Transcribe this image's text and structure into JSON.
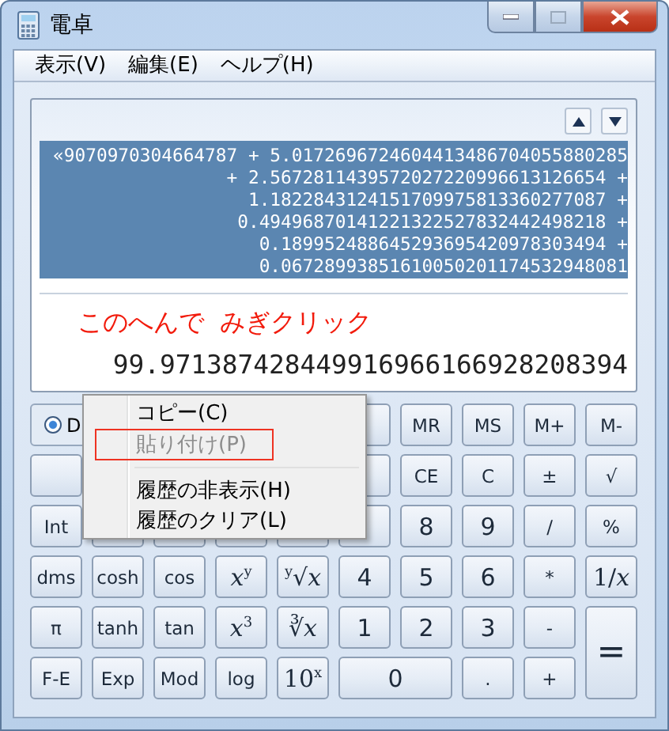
{
  "window": {
    "title": "電卓"
  },
  "menu_bar": [
    "表示(V)",
    "編集(E)",
    "ヘルプ(H)"
  ],
  "display": {
    "history_selected": true,
    "history": [
      "«9070970304664787 + 5.0172696724604413486704055880285",
      "+ 2.5672811439572027220996613126654 +",
      "1.1822843124151709975813360277087 +",
      "0.49496870141221322527832442498218 +",
      "0.189952488645293695420978303494 +",
      "0.06728993851610050201174532948081"
    ],
    "annotation": "このへんで  みぎクリック",
    "result": "99.971387428449916966166928208394"
  },
  "keys": [
    {
      "kind": "radio",
      "label": "D",
      "selected": true
    },
    {
      "kind": "covered"
    },
    {
      "kind": "key",
      "label": "MR"
    },
    {
      "kind": "key",
      "label": "MS"
    },
    {
      "kind": "key",
      "label": "M+"
    },
    {
      "kind": "key",
      "label": "M-"
    },
    {
      "kind": "covered"
    },
    {
      "kind": "hidden"
    },
    {
      "kind": "hidden"
    },
    {
      "kind": "hidden"
    },
    {
      "kind": "hidden"
    },
    {
      "kind": "covered"
    },
    {
      "kind": "key",
      "label": "CE"
    },
    {
      "kind": "key",
      "label": "C"
    },
    {
      "kind": "key",
      "label": "±"
    },
    {
      "kind": "key",
      "label": "√"
    },
    {
      "kind": "key",
      "label": "Int"
    },
    {
      "kind": "covered"
    },
    {
      "kind": "covered"
    },
    {
      "kind": "covered"
    },
    {
      "kind": "covered"
    },
    {
      "kind": "covered"
    },
    {
      "kind": "digit",
      "label": "8"
    },
    {
      "kind": "digit",
      "label": "9"
    },
    {
      "kind": "key",
      "label": "/"
    },
    {
      "kind": "key",
      "label": "%"
    },
    {
      "kind": "key",
      "label": "dms"
    },
    {
      "kind": "key",
      "label": "cosh"
    },
    {
      "kind": "key",
      "label": "cos"
    },
    {
      "kind": "math",
      "label": "*x*$^{y}$"
    },
    {
      "kind": "math",
      "label": "$^{y}$√*x*"
    },
    {
      "kind": "digit",
      "label": "4"
    },
    {
      "kind": "digit",
      "label": "5"
    },
    {
      "kind": "digit",
      "label": "6"
    },
    {
      "kind": "key",
      "label": "*"
    },
    {
      "kind": "math",
      "label": "1/*x*"
    },
    {
      "kind": "key",
      "label": "π"
    },
    {
      "kind": "key",
      "label": "tanh"
    },
    {
      "kind": "key",
      "label": "tan"
    },
    {
      "kind": "math",
      "label": "*x*$^{3}$"
    },
    {
      "kind": "math",
      "label": "∛*x*"
    },
    {
      "kind": "digit",
      "label": "1"
    },
    {
      "kind": "digit",
      "label": "2"
    },
    {
      "kind": "digit",
      "label": "3"
    },
    {
      "kind": "key",
      "label": "-"
    },
    {
      "kind": "tall",
      "label": "="
    },
    {
      "kind": "key",
      "label": "F-E"
    },
    {
      "kind": "key",
      "label": "Exp"
    },
    {
      "kind": "key",
      "label": "Mod"
    },
    {
      "kind": "key",
      "label": "log"
    },
    {
      "kind": "math",
      "label": "10$^{x}$"
    },
    {
      "kind": "wide",
      "label": "0"
    },
    {
      "kind": "key",
      "label": "."
    },
    {
      "kind": "key",
      "label": "+"
    }
  ],
  "context_menu": [
    {
      "kind": "item",
      "label": "コピー(C)",
      "disabled": false,
      "highlighted": false
    },
    {
      "kind": "item",
      "label": "貼り付け(P)",
      "disabled": true,
      "highlighted": true
    },
    {
      "kind": "separator"
    },
    {
      "kind": "item",
      "label": "履歴の非表示(H)",
      "disabled": false,
      "highlighted": false
    },
    {
      "kind": "item",
      "label": "履歴のクリア(L)",
      "disabled": false,
      "highlighted": false
    }
  ]
}
